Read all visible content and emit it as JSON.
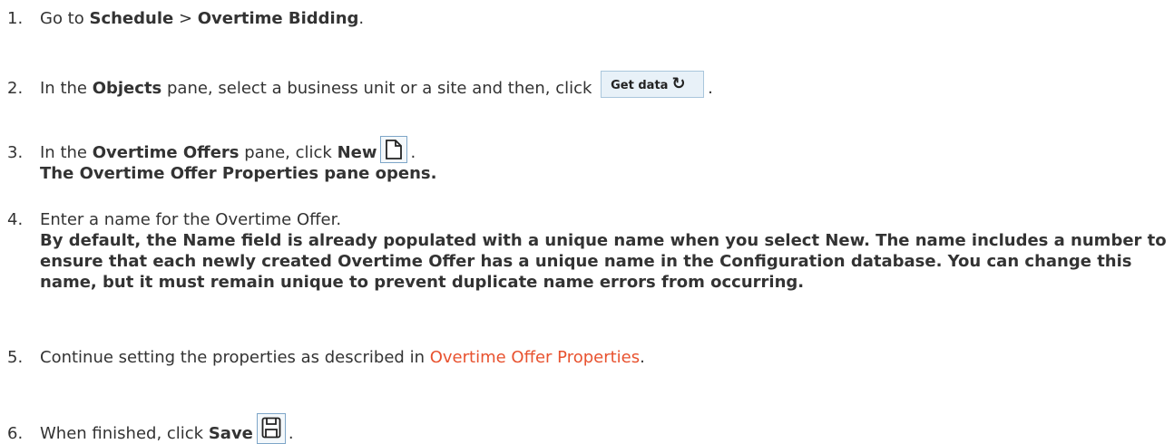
{
  "steps": [
    {
      "num": "1.",
      "pre": "Go to ",
      "b1": "Schedule",
      "sep": " > ",
      "b2": "Overtime Bidding",
      "post": "."
    },
    {
      "num": "2.",
      "pre": "In the ",
      "b1": "Objects",
      "mid": " pane, select a business unit or a site and then, click ",
      "button_label": "Get data",
      "post": "."
    },
    {
      "num": "3.",
      "pre": "In the ",
      "b1": "Overtime Offers",
      "mid": " pane, click ",
      "b2": "New",
      "post": ".",
      "result": "The Overtime Offer Properties pane opens."
    },
    {
      "num": "4.",
      "text": "Enter a name for the Overtime Offer.",
      "result": "By default, the Name field is already populated with a unique name when you select New. The name includes a number to ensure that each newly created Overtime Offer has a unique name in the Configuration database. You can change this name, but it must remain unique to prevent duplicate name errors from occurring."
    },
    {
      "num": "5.",
      "pre": "Continue setting the properties as described in ",
      "link": "Overtime Offer Properties",
      "post": "."
    },
    {
      "num": "6.",
      "pre": "When finished, click ",
      "b1": "Save",
      "post": "."
    }
  ],
  "icons": {
    "get_data_refresh": "refresh-icon",
    "new": "new-document-icon",
    "save": "save-floppy-icon"
  },
  "colors": {
    "text": "#333333",
    "link": "#e8522f"
  }
}
